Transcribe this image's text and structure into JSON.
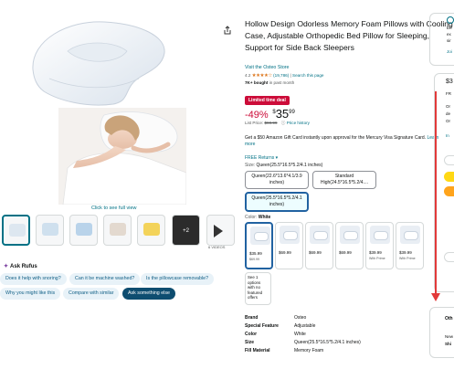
{
  "gallery": {
    "see_full_view": "Click to see full view",
    "more_label": "+2",
    "video_label": "6 VIDEOS"
  },
  "ask": {
    "title": "Ask Rufus",
    "chips": [
      "Does it help with snoring?",
      "Can it be machine washed?",
      "Is the pillowcase removable?",
      "Why you might like this",
      "Compare with similar",
      "Ask something else"
    ]
  },
  "product": {
    "title": "Hollow Design Odorless Memory Foam Pillows with Cooling Case, Adjustable Orthopedic Bed Pillow for Sleeping, Support for Side Back Sleepers",
    "store_link": "Visit the Osteo Store",
    "rating_value": "4.2",
    "stars": "★★★★☆",
    "rating_count": "(19,786)",
    "search_link": "Search this page",
    "bought": "7K+ bought",
    "bought_suffix": "in past month",
    "deal_badge": "Limited time deal",
    "discount": "-49%",
    "price_currency": "$",
    "price_whole": "35",
    "price_fraction": "99",
    "list_price_label": "List Price:",
    "list_price": "$69.99",
    "price_history": "Price history",
    "gift_card": "Get a $50 Amazon Gift Card instantly upon approval for the Mercury Visa Signature Card.",
    "learn_more": "Learn more",
    "returns": "FREE Returns ▾",
    "size_label": "Size:",
    "size_value": "Queen(25.5*16.5*5.2/4.1 inches)",
    "size_options": [
      "Queen(22.6*13.6*4.1/3.9 inches)",
      "Standard High(24.5*16.5*5.2/4....",
      "Queen(25.5*16.5*5.2/4.1 inches)"
    ],
    "color_label": "Color:",
    "color_value": "White",
    "swatches": [
      {
        "price": "$35.99",
        "sub": "$69.99"
      },
      {
        "price": "$69.99",
        "sub": ""
      },
      {
        "price": "$69.99",
        "sub": ""
      },
      {
        "price": "$69.99",
        "sub": ""
      },
      {
        "price": "$39.99",
        "sub": "With Prime"
      },
      {
        "price": "$39.99",
        "sub": "With Prime"
      }
    ],
    "see_options": "See 1 options with no featured offers",
    "specs": [
      {
        "k": "Brand",
        "v": "Osteo"
      },
      {
        "k": "Special Feature",
        "v": "Adjustable"
      },
      {
        "k": "Color",
        "v": "White"
      },
      {
        "k": "Size",
        "v": "Queen(25.5*16.5*5.2/4.1 inches)"
      },
      {
        "k": "Fill Material",
        "v": "Memory Foam"
      }
    ]
  },
  "buybox": {
    "top_lines": [
      "En",
      "ex",
      "sir"
    ],
    "top_link": "Joi",
    "price_fragment": "$3",
    "lines": [
      "FR",
      "Or",
      "de",
      "Or",
      "In"
    ],
    "other_title": "Oth",
    "other_lines": [
      "New",
      "Shi"
    ]
  },
  "colors": {
    "link": "#007185",
    "deal": "#cc0c39",
    "selected_border": "#2162a1",
    "chip_bg": "#e8f2f8",
    "chip_dark": "#0e4d70",
    "add_to_cart": "#ffd814",
    "buy_now": "#ffa41c",
    "annotation_arrow": "#e23a3a"
  }
}
